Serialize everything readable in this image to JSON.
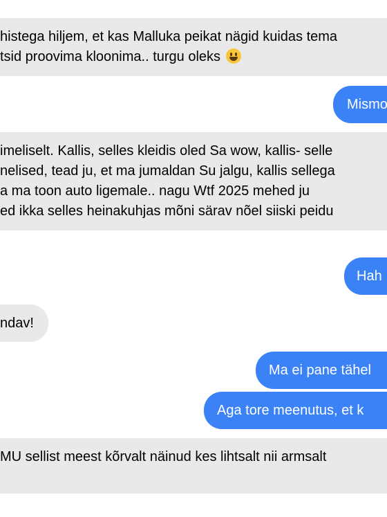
{
  "colors": {
    "incoming_bubble": "#e9e9eb",
    "outgoing_bubble": "#3b82f6",
    "incoming_text": "#000000",
    "outgoing_text": "#ffffff"
  },
  "messages": [
    {
      "direction": "incoming",
      "lines": [
        "histega hiljem, et kas Malluka peikat nägid kuidas tema",
        "tsid proovima kloonima.. turgu oleks"
      ],
      "emoji": "grinning-face-emoji"
    },
    {
      "direction": "outgoing",
      "lines": [
        "Mismo"
      ]
    },
    {
      "direction": "incoming",
      "lines": [
        " imeliselt. Kallis, selles kleidis oled Sa wow, kallis- selle",
        "nelised, tead ju, et ma jumaldan Su jalgu, kallis sellega",
        "a ma toon auto ligemale.. nagu Wtf 2025 mehed ju",
        "ed ikka selles heinakuhjas mõni särav nõel siiski peidu"
      ]
    },
    {
      "direction": "outgoing",
      "lines": [
        "Hah"
      ]
    },
    {
      "direction": "incoming",
      "lines": [
        "ndav!"
      ]
    },
    {
      "direction": "outgoing",
      "lines": [
        "Ma ei pane tähel"
      ]
    },
    {
      "direction": "outgoing",
      "lines": [
        "Aga tore meenutus, et k"
      ]
    },
    {
      "direction": "incoming",
      "lines": [
        "MU sellist meest kõrvalt näinud kes lihtsalt nii armsalt"
      ]
    }
  ]
}
